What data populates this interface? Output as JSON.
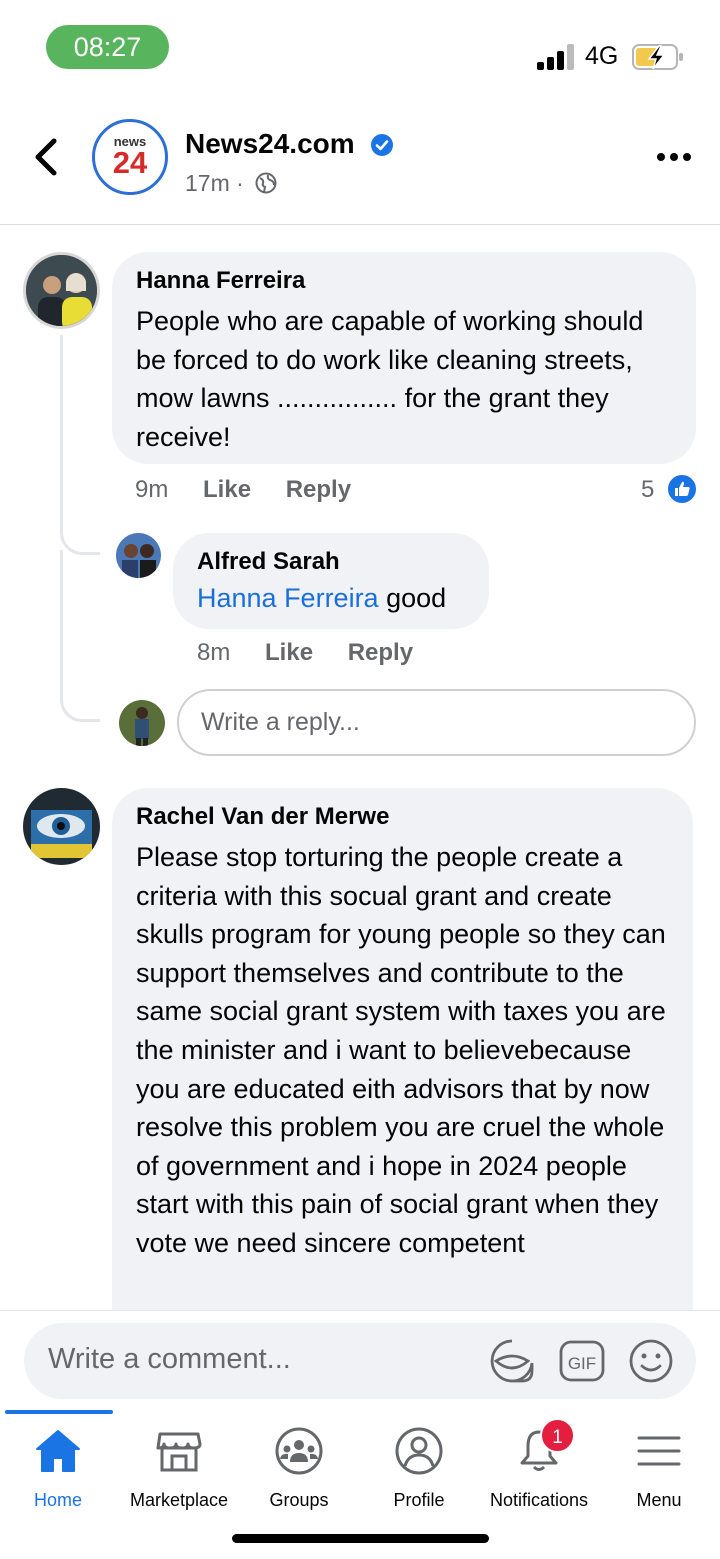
{
  "status": {
    "time": "08:27",
    "network": "4G"
  },
  "header": {
    "logo_small": "news",
    "logo_big": "24",
    "page_name": "News24.com",
    "age": "17m",
    "separator": "·"
  },
  "comments": [
    {
      "name": "Hanna Ferreira",
      "text": "People who are capable of working should be forced to do work like cleaning streets, mow lawns ................ for the grant they receive!",
      "time": "9m",
      "like": "Like",
      "reply": "Reply",
      "reactions": "5"
    },
    {
      "name": "Rachel Van der Merwe",
      "text": "Please stop torturing the people create a criteria with this socual grant and create skulls program for young people so they can support themselves and contribute to the same social grant system with taxes you are the minister and i want to believebecause you are educated eith advisors that by now resolve this problem you are cruel the whole of government and i hope in 2024 people start with this pain of social grant when they vote we need sincere competent"
    }
  ],
  "reply": {
    "name": "Alfred Sarah",
    "mention": "Hanna Ferreira",
    "text": " good",
    "time": "8m",
    "like": "Like",
    "reply": "Reply"
  },
  "reply_input": {
    "placeholder": "Write a reply..."
  },
  "composer": {
    "placeholder": "Write a comment..."
  },
  "tabs": [
    {
      "label": "Home",
      "icon": "home-icon"
    },
    {
      "label": "Marketplace",
      "icon": "marketplace-icon"
    },
    {
      "label": "Groups",
      "icon": "groups-icon"
    },
    {
      "label": "Profile",
      "icon": "profile-icon"
    },
    {
      "label": "Notifications",
      "icon": "bell-icon",
      "badge": "1"
    },
    {
      "label": "Menu",
      "icon": "hamburger-icon"
    }
  ],
  "colors": {
    "accent": "#1b74e4",
    "time_pill": "#58b55e",
    "badge": "#e41e3f",
    "bubble": "#f0f2f5"
  }
}
